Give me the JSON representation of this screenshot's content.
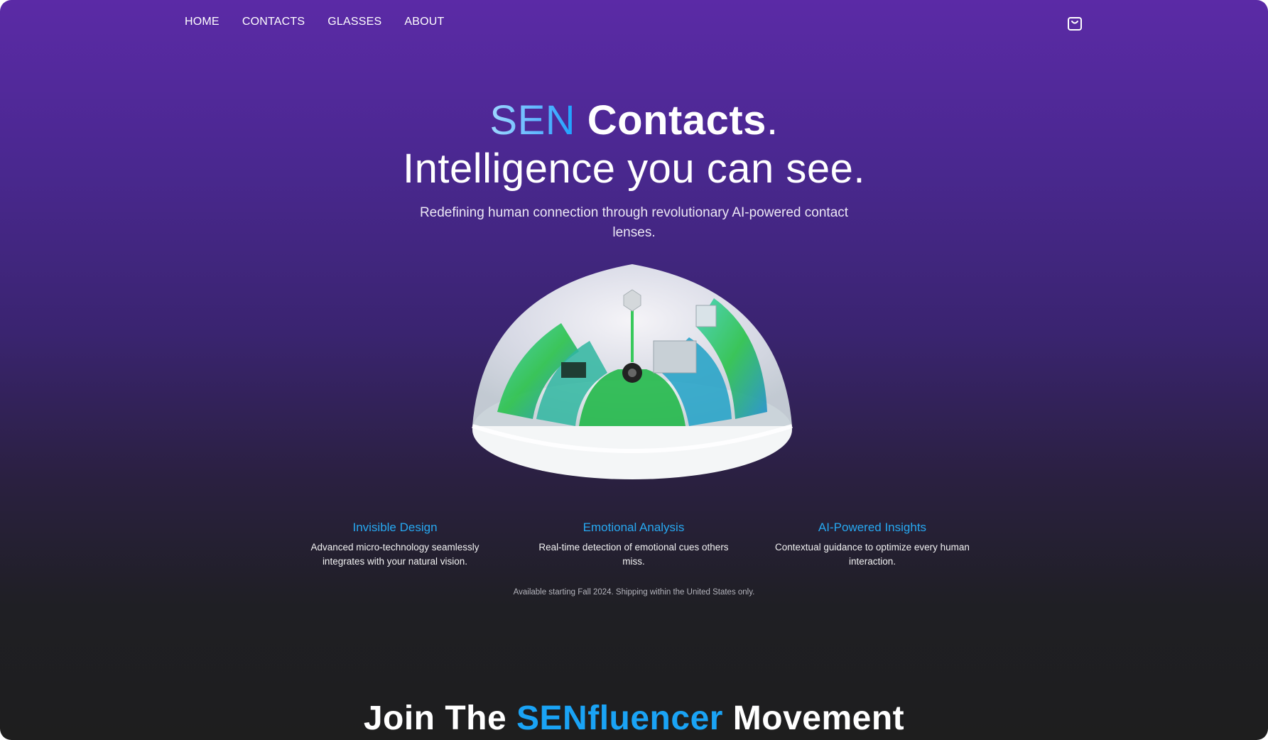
{
  "nav": {
    "items": [
      {
        "label": "HOME"
      },
      {
        "label": "CONTACTS"
      },
      {
        "label": "GLASSES"
      },
      {
        "label": "ABOUT"
      }
    ],
    "cart_icon": "shopping-bag-icon"
  },
  "hero": {
    "title_brand": "SEN",
    "title_product": "Contacts",
    "title_period": ".",
    "tagline": "Intelligence you can see.",
    "subtitle": "Redefining human connection through revolutionary AI-powered contact lenses."
  },
  "features": [
    {
      "title": "Invisible Design",
      "text": "Advanced micro-technology seamlessly integrates with your natural vision."
    },
    {
      "title": "Emotional Analysis",
      "text": "Real-time detection of emotional cues others miss."
    },
    {
      "title": "AI-Powered Insights",
      "text": "Contextual guidance to optimize every human interaction."
    }
  ],
  "availability": "Available starting Fall 2024. Shipping within the United States only.",
  "join": {
    "prefix": "Join The ",
    "accent": "SENfluencer",
    "suffix": " Movement"
  },
  "colors": {
    "accent": "#1aa3f5",
    "gradient_top": "#5b2aa6",
    "background_bottom": "#1e1e1e"
  }
}
